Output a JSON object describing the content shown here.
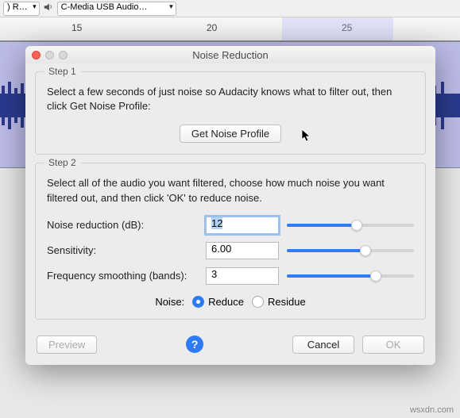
{
  "toolbar": {
    "left_select_suffix": ") R…",
    "output_device": "C-Media USB Audio…"
  },
  "ruler": {
    "marks": [
      {
        "label": "15",
        "pos": 90
      },
      {
        "label": "20",
        "pos": 260
      },
      {
        "label": "25",
        "pos": 430
      }
    ]
  },
  "dialog": {
    "title": "Noise Reduction",
    "step1": {
      "legend": "Step 1",
      "text": "Select a few seconds of just noise so Audacity knows what to filter out, then click Get Noise Profile:",
      "button": "Get Noise Profile"
    },
    "step2": {
      "legend": "Step 2",
      "text": "Select all of the audio you want filtered, choose how much noise you want filtered out, and then click 'OK' to reduce noise.",
      "fields": {
        "noise_reduction": {
          "label": "Noise reduction (dB):",
          "value": "12",
          "slider_pct": 55
        },
        "sensitivity": {
          "label": "Sensitivity:",
          "value": "6.00",
          "slider_pct": 62
        },
        "frequency_smoothing": {
          "label": "Frequency smoothing (bands):",
          "value": "3",
          "slider_pct": 70
        }
      },
      "noise_label": "Noise:",
      "radio": {
        "reduce": "Reduce",
        "residue": "Residue",
        "selected": "reduce"
      }
    },
    "buttons": {
      "preview": "Preview",
      "cancel": "Cancel",
      "ok": "OK"
    }
  },
  "watermark": "wsxdn.com"
}
